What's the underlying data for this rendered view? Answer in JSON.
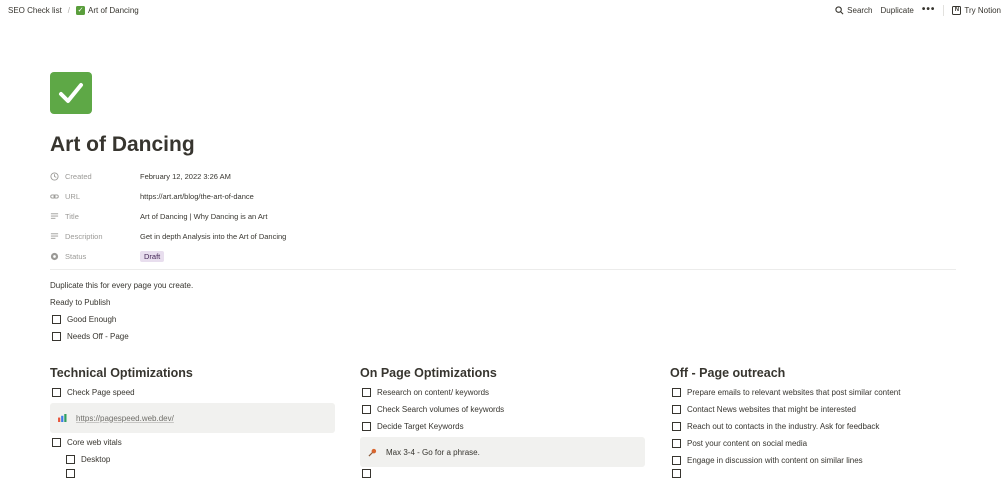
{
  "breadcrumb": {
    "parent": "SEO Check list",
    "current": "Art of Dancing"
  },
  "topbar": {
    "search": "Search",
    "duplicate": "Duplicate",
    "more": "•••",
    "try_notion": "Try Notion"
  },
  "page": {
    "title": "Art of Dancing",
    "icon": "check-mark-icon",
    "accent": "#5ea846"
  },
  "properties": [
    {
      "key": "Created",
      "icon": "clock-icon",
      "value": "February 12, 2022 3:26 AM"
    },
    {
      "key": "URL",
      "icon": "link-icon",
      "value": "https://art.art/blog/the-art-of-dance"
    },
    {
      "key": "Title",
      "icon": "text-lines-icon",
      "value": "Art of Dancing | Why Dancing is an Art"
    },
    {
      "key": "Description",
      "icon": "text-lines-icon",
      "value": "Get in depth Analysis into the Art of Dancing"
    },
    {
      "key": "Status",
      "icon": "status-icon",
      "value": "Draft"
    }
  ],
  "intro": {
    "line1": "Duplicate this for every page you create.",
    "line2": "Ready to Publish",
    "todos": [
      "Good Enough",
      "Needs Off - Page"
    ]
  },
  "columns": {
    "technical": {
      "heading": "Technical Optimizations",
      "todo1": "Check Page speed",
      "link": "https://pagespeed.web.dev/",
      "todo2": "Core web vitals",
      "sub1": "Desktop"
    },
    "onpage": {
      "heading": "On Page Optimizations",
      "todos": [
        "Research on content/ keywords",
        "Check Search volumes of keywords",
        "Decide Target Keywords"
      ],
      "callout": "Max 3-4 - Go for a phrase."
    },
    "offpage": {
      "heading": "Off - Page outreach",
      "todos": [
        "Prepare emails to relevant websites that post similar content",
        "Contact News websites that might be interested",
        "Reach out to contacts in the industry. Ask for feedback",
        "Post your content on social media",
        "Engage in discussion with content on similar lines"
      ]
    }
  }
}
